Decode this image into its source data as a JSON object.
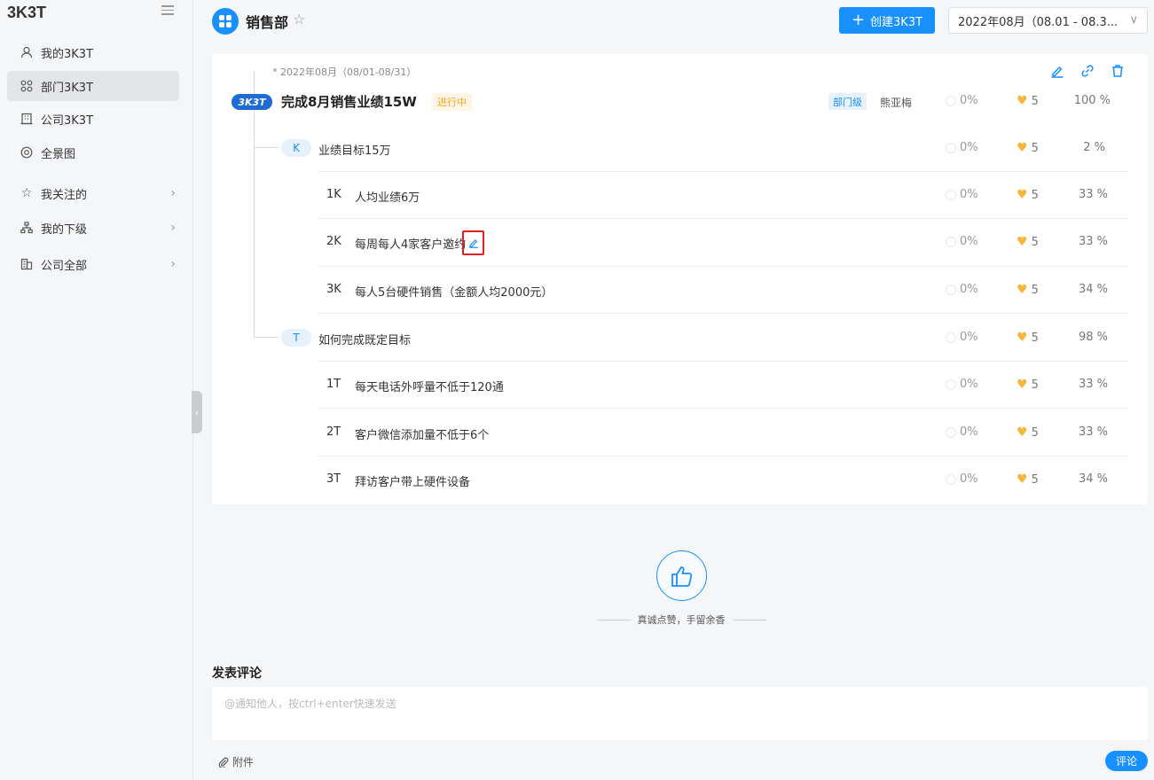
{
  "sidebar": {
    "brand": "3K3T",
    "items": [
      {
        "label": "我的3K3T",
        "icon": "user-icon"
      },
      {
        "label": "部门3K3T",
        "icon": "grid-icon"
      },
      {
        "label": "公司3K3T",
        "icon": "building-icon"
      },
      {
        "label": "全景图",
        "icon": "target-icon"
      },
      {
        "label": "我关注的",
        "icon": "star-icon"
      },
      {
        "label": "我的下级",
        "icon": "org-icon"
      },
      {
        "label": "公司全部",
        "icon": "company-icon"
      }
    ]
  },
  "header": {
    "title": "销售部",
    "create_label": "创建3K3T",
    "period": "2022年08月（08.01 - 08.3..."
  },
  "objective": {
    "period_label": "2022年08月（08/01-08/31）",
    "badge": "3K3T",
    "title": "完成8月销售业绩15W",
    "status": "进行中",
    "level": "部门级",
    "owner": "熊亚梅",
    "progress": "0%",
    "likes": "5",
    "weight": "100 %"
  },
  "groups": [
    {
      "badge": "K",
      "title": "业绩目标15万",
      "progress": "0%",
      "likes": "5",
      "weight": "2 %",
      "items": [
        {
          "code": "1K",
          "text": "人均业绩6万",
          "progress": "0%",
          "likes": "5",
          "weight": "33 %"
        },
        {
          "code": "2K",
          "text": "每周每人4家客户邀约",
          "progress": "0%",
          "likes": "5",
          "weight": "33 %"
        },
        {
          "code": "3K",
          "text": "每人5台硬件销售（金额人均2000元）",
          "progress": "0%",
          "likes": "5",
          "weight": "34 %"
        }
      ]
    },
    {
      "badge": "T",
      "title": "如何完成既定目标",
      "progress": "0%",
      "likes": "5",
      "weight": "98 %",
      "items": [
        {
          "code": "1T",
          "text": "每天电话外呼量不低于120通",
          "progress": "0%",
          "likes": "5",
          "weight": "33 %"
        },
        {
          "code": "2T",
          "text": "客户微信添加量不低于6个",
          "progress": "0%",
          "likes": "5",
          "weight": "33 %"
        },
        {
          "code": "3T",
          "text": "拜访客户带上硬件设备",
          "progress": "0%",
          "likes": "5",
          "weight": "34 %"
        }
      ]
    }
  ],
  "like": {
    "text": "真诚点赞，手留余香"
  },
  "comment": {
    "title": "发表评论",
    "placeholder": "@通知他人，按ctrl+enter快速发送",
    "attach_label": "附件",
    "submit_label": "评论"
  },
  "colors": {
    "accent": "#1890ff",
    "status": "#f5a623",
    "heart": "#f6b73c",
    "highlight": "#e02020"
  }
}
